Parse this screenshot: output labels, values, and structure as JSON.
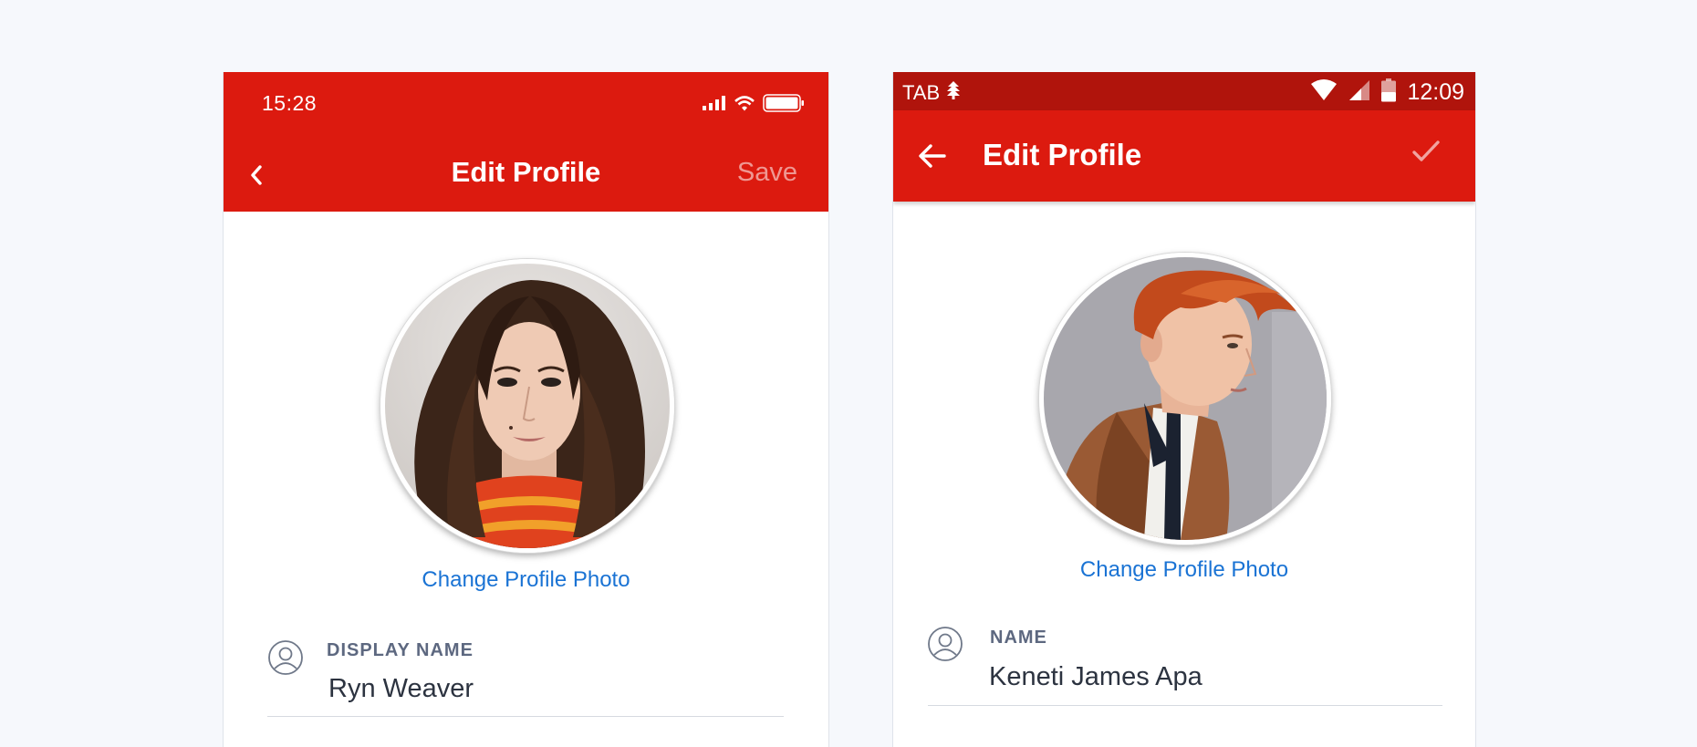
{
  "ios": {
    "time": "15:28",
    "title": "Edit Profile",
    "save_label": "Save",
    "change_photo": "Change Profile Photo",
    "field_label": "DISPLAY NAME",
    "field_value": "Ryn Weaver"
  },
  "android": {
    "tab_label": "TAB",
    "time": "12:09",
    "title": "Edit Profile",
    "change_photo": "Change Profile Photo",
    "field_label": "NAME",
    "field_value": "Keneti James Apa"
  },
  "colors": {
    "accent": "#dc1a0f",
    "status_bar_dark": "#b0140c",
    "link": "#1a73d4",
    "label": "#5d6880"
  },
  "icons": [
    "back-chevron-icon",
    "signal-icon",
    "wifi-icon",
    "battery-icon",
    "back-arrow-icon",
    "check-icon",
    "user-icon",
    "cell-signal-icon",
    "notification-icon"
  ]
}
